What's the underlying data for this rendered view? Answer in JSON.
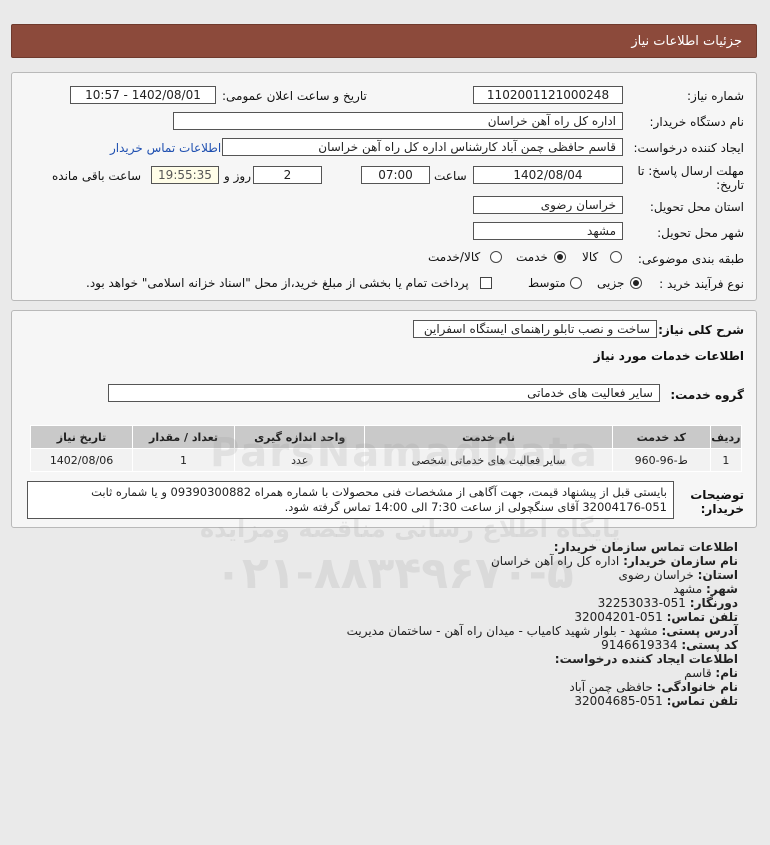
{
  "header": {
    "title": "جزئیات اطلاعات نیاز"
  },
  "form": {
    "need_number_label": "شماره نیاز:",
    "need_number": "1102001121000248",
    "announce_label": "تاریخ و ساعت اعلان عمومی:",
    "announce_value": "1402/08/01 - 10:57",
    "buyer_org_label": "نام دستگاه خریدار:",
    "buyer_org": "اداره کل راه آهن خراسان",
    "creator_label": "ایجاد کننده درخواست:",
    "creator": "قاسم حافظی چمن آباد کارشناس اداره کل راه آهن خراسان",
    "buyer_contact_link": "اطلاعات تماس خریدار",
    "deadline_label_1": "مهلت ارسال پاسخ: تا",
    "deadline_label_2": "تاریخ:",
    "deadline_date": "1402/08/04",
    "time_label": "ساعت",
    "deadline_time": "07:00",
    "days_value": "2",
    "days_label": "روز و",
    "remaining_time": "19:55:35",
    "remaining_label": "ساعت باقی مانده",
    "province_label": "استان محل تحویل:",
    "province": "خراسان رضوی",
    "city_label": "شهر محل تحویل:",
    "city": "مشهد",
    "category_label": "طبقه بندی موضوعی:",
    "category_options": [
      "کالا",
      "خدمت",
      "کالا/خدمت"
    ],
    "process_label": "نوع فرآیند خرید :",
    "process_options": [
      "جزیی",
      "متوسط"
    ],
    "payment_note": "پرداخت تمام یا بخشی از مبلغ خرید،از محل \"اسناد خزانه اسلامی\" خواهد بود."
  },
  "description": {
    "general_label": "شرح کلی نیاز:",
    "general_value": "ساخت و نصب تابلو راهنمای ایستگاه اسفراین",
    "services_title": "اطلاعات خدمات مورد نیاز",
    "service_group_label": "گروه خدمت:",
    "service_group": "سایر فعالیت های خدماتی"
  },
  "table": {
    "headers": [
      "ردیف",
      "کد خدمت",
      "نام خدمت",
      "واحد اندازه گیری",
      "تعداد / مقدار",
      "تاریخ نیاز"
    ],
    "rows": [
      [
        "1",
        "ط-96-960",
        "سایر فعالیت های خدماتی شخصی",
        "عدد",
        "1",
        "1402/08/06"
      ]
    ]
  },
  "buyer_notes": {
    "label_1": "توضیحات",
    "label_2": "خریدار:",
    "line_1": "بایستی قبل از پیشنهاد قیمت، جهت آگاهی از مشخصات فنی محصولات با شماره همراه 09390300882 و یا شماره ثابت",
    "line_2": "32004176-051 آقای سنگچولی از ساعت 7:30 الی 14:00 تماس گرفته شود."
  },
  "contact": {
    "org_title": "اطلاعات تماس سازمان خریدار:",
    "org_name_label": "نام سازمان خریدار:",
    "org_name": "اداره کل راه آهن خراسان",
    "province_label": "استان:",
    "province": "خراسان رضوی",
    "city_label": "شهر:",
    "city": "مشهد",
    "fax_label": "دورنگار:",
    "fax": "051-32253033",
    "phone_label": "تلفن تماس:",
    "phone": "051-32004201",
    "address_label": "آدرس پستی:",
    "address": "مشهد - بلوار شهید کامیاب - میدان راه آهن - ساختمان مدیریت",
    "postal_label": "کد پستی:",
    "postal": "9146619334",
    "creator_title": "اطلاعات ایجاد کننده درخواست:",
    "first_name_label": "نام:",
    "first_name": "قاسم",
    "last_name_label": "نام خانوادگی:",
    "last_name": "حافظی چمن آباد",
    "creator_phone_label": "تلفن تماس:",
    "creator_phone": "051-32004685"
  },
  "watermark": {
    "site": "ParsNamadData",
    "tagline": "پایگاه اطلاع رسانی مناقصه ومزایده",
    "phone": "۰۲۱-۸۸۳۴۹۶۷۰-۵"
  }
}
